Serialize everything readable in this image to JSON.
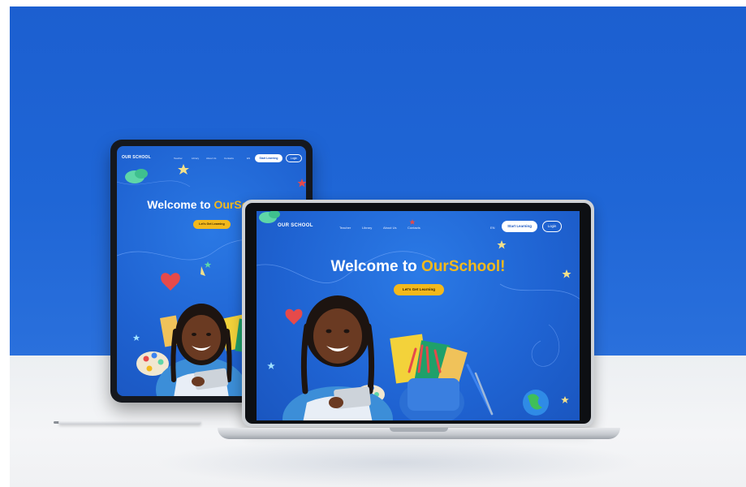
{
  "site": {
    "logo": "OUR SCHOOL",
    "nav_links": [
      "Teacher",
      "Library",
      "About Us",
      "Contacts"
    ],
    "lang": "EN",
    "start_button": "Start Learning",
    "login_button": "Login",
    "headline_prefix": "Welcome to ",
    "headline_accent": "OurSchool!",
    "cta_button": "Let's Get Learning"
  },
  "colors": {
    "background_blue": "#1f63d2",
    "accent_yellow": "#f3b91c",
    "white": "#ffffff"
  }
}
